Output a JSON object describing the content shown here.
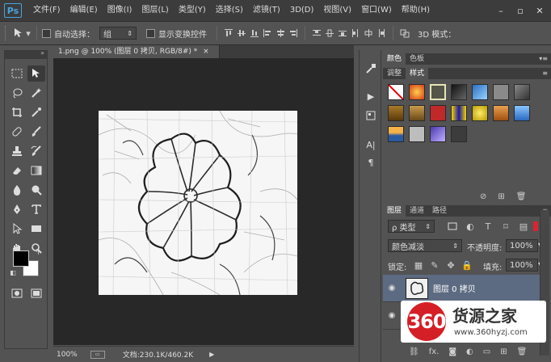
{
  "app": {
    "logo": "Ps"
  },
  "menubar": {
    "items": [
      "文件(F)",
      "编辑(E)",
      "图像(I)",
      "图层(L)",
      "类型(Y)",
      "选择(S)",
      "滤镜(T)",
      "3D(D)",
      "视图(V)",
      "窗口(W)",
      "帮助(H)"
    ],
    "window_controls": [
      "–",
      "▫",
      "✕"
    ]
  },
  "options": {
    "move_tool_icon": "move-tool-icon",
    "auto_select_label": "自动选择：",
    "auto_select_value": "组",
    "show_transform_label": "显示变换控件",
    "mode_3d_label": "3D 模式："
  },
  "document": {
    "tab_title": "1.png @ 100% (图层 0 拷贝, RGB/8#) *",
    "tab_close": "×"
  },
  "statusbar": {
    "zoom": "100%",
    "doc_size": "文档:230.1K/460.2K"
  },
  "panels": {
    "color_tabs": [
      "颜色",
      "色板"
    ],
    "style_tabs": [
      "调整",
      "样式"
    ],
    "layers_tabs": [
      "图层",
      "通道",
      "路径"
    ],
    "filter_kind": "ρ 类型",
    "blend_mode": "颜色减淡",
    "opacity_label": "不透明度:",
    "opacity_value": "100%",
    "lock_label": "锁定:",
    "fill_label": "填充:",
    "fill_value": "100%",
    "layers": [
      {
        "name": "图层 0 拷贝",
        "selected": true
      },
      {
        "name": "",
        "selected": false
      }
    ]
  },
  "watermark": {
    "badge": "360",
    "title": "货源之家",
    "url": "www.360hyzj.com"
  },
  "colors": {
    "accent": "#4aa3df",
    "selected_layer": "#5d6b82",
    "watermark_red": "#d41f26"
  }
}
